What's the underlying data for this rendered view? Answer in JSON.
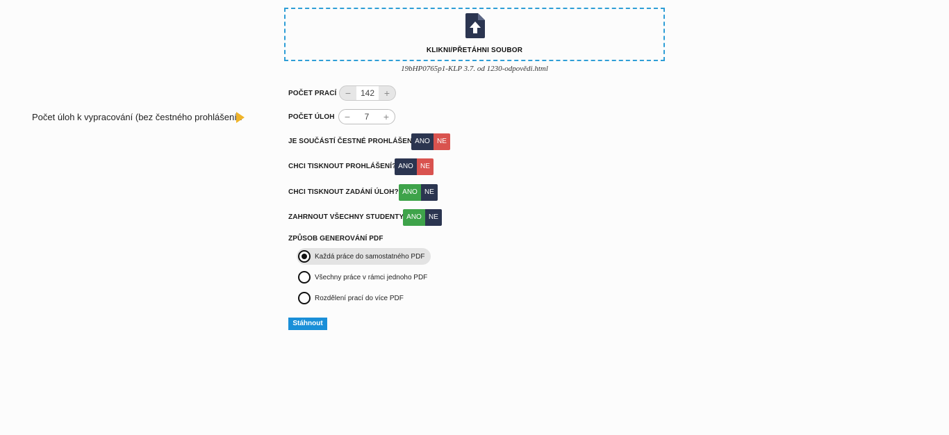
{
  "upload": {
    "label": "KLIKNI/PŘETÁHNI SOUBOR",
    "filename": "19bHP0765p1-KLP 3.7. od 1230-odpovědi.html",
    "border_color": "#2e9ed6"
  },
  "hint": {
    "text": "Počet úloh k vypracování (bez čestného prohlášení).",
    "arrow_color": "#f0b429"
  },
  "fields": {
    "pocet_praci": {
      "label": "POČET PRACÍ",
      "value": "142",
      "minus": "−",
      "plus": "+"
    },
    "pocet_uloh": {
      "label": "POČET ÚLOH",
      "value": "7",
      "minus": "−",
      "plus": "+"
    }
  },
  "toggles": {
    "cestne": {
      "label": "JE SOUČÁSTÍ ČESTNÉ PROHLÁŠENÍ?",
      "ano": "ANO",
      "ne": "NE",
      "selected": "NE"
    },
    "tisk_prohlaseni": {
      "label": "CHCI TISKNOUT PROHLÁŠENÍ?",
      "ano": "ANO",
      "ne": "NE",
      "selected": "NE"
    },
    "tisk_zadani": {
      "label": "CHCI TISKNOUT ZADÁNÍ ÚLOH?",
      "ano": "ANO",
      "ne": "NE",
      "selected": "ANO"
    },
    "vsichni_studenti": {
      "label": "ZAHRNOUT VŠECHNY STUDENTY",
      "ano": "ANO",
      "ne": "NE",
      "selected": "ANO"
    }
  },
  "pdf_mode": {
    "label": "ZPŮSOB GENEROVÁNÍ PDF",
    "options": [
      {
        "label": "Každá práce do samostatného PDF",
        "selected": true
      },
      {
        "label": "Všechny práce v rámci jednoho PDF",
        "selected": false
      },
      {
        "label": "Rozdělení prací do více PDF",
        "selected": false
      }
    ]
  },
  "download": {
    "label": "Stáhnout"
  },
  "colors": {
    "navy": "#2b3550",
    "red": "#d9534f",
    "green": "#3ea34a",
    "blue": "#1a8fd8"
  }
}
